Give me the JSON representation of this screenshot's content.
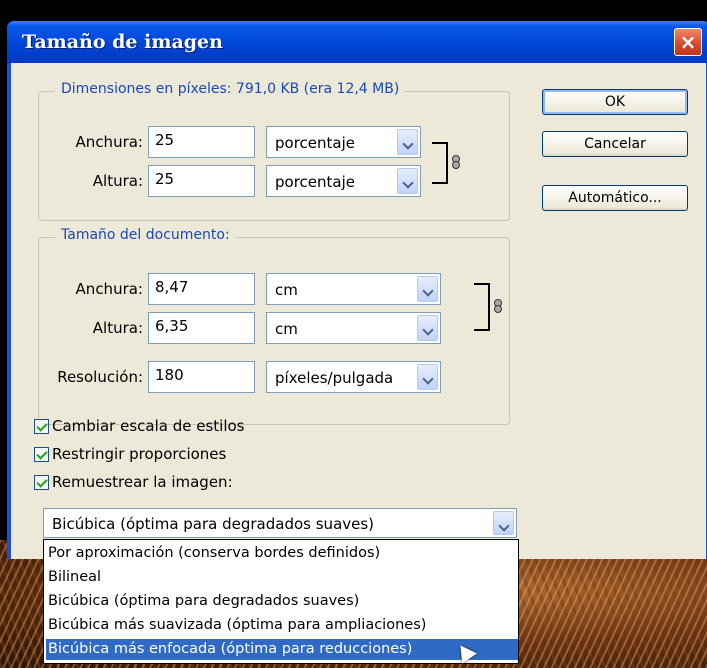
{
  "window": {
    "title": "Tamaño de imagen",
    "close_glyph": "×"
  },
  "pixel_dimensions": {
    "legend": "Dimensiones en píxeles: 791,0 KB (era 12,4 MB)",
    "width": {
      "label": "Anchura:",
      "value": "25",
      "unit": "porcentaje"
    },
    "height": {
      "label": "Altura:",
      "value": "25",
      "unit": "porcentaje"
    }
  },
  "document_size": {
    "legend": "Tamaño del documento:",
    "width": {
      "label": "Anchura:",
      "value": "8,47",
      "unit": "cm"
    },
    "height": {
      "label": "Altura:",
      "value": "6,35",
      "unit": "cm"
    },
    "resolution": {
      "label": "Resolución:",
      "value": "180",
      "unit": "píxeles/pulgada"
    }
  },
  "buttons": {
    "ok": "OK",
    "cancel": "Cancelar",
    "auto": "Automático..."
  },
  "checkboxes": {
    "scale_styles": {
      "label": "Cambiar escala de estilos",
      "checked": true
    },
    "constrain": {
      "label": "Restringir proporciones",
      "checked": true
    },
    "resample": {
      "label": "Remuestrear la imagen:",
      "checked": true
    }
  },
  "resample_select": {
    "selected": "Bicúbica (óptima para degradados suaves)",
    "options": [
      "Por aproximación (conserva bordes definidos)",
      "Bilineal",
      "Bicúbica (óptima para degradados suaves)",
      "Bicúbica más suavizada (óptima para ampliaciones)",
      "Bicúbica más enfocada (óptima para reducciones)"
    ],
    "highlighted_option": "Bicúbica más enfocada (óptima para reducciones)"
  },
  "colors": {
    "titlebar": "#0046d6",
    "legend_text": "#1a48b8",
    "highlight": "#316ac5",
    "close_button": "#d4472a"
  },
  "icons": [
    "close-icon",
    "link-icon",
    "chevron-down-icon",
    "checkmark-icon",
    "mouse-pointer-icon"
  ]
}
